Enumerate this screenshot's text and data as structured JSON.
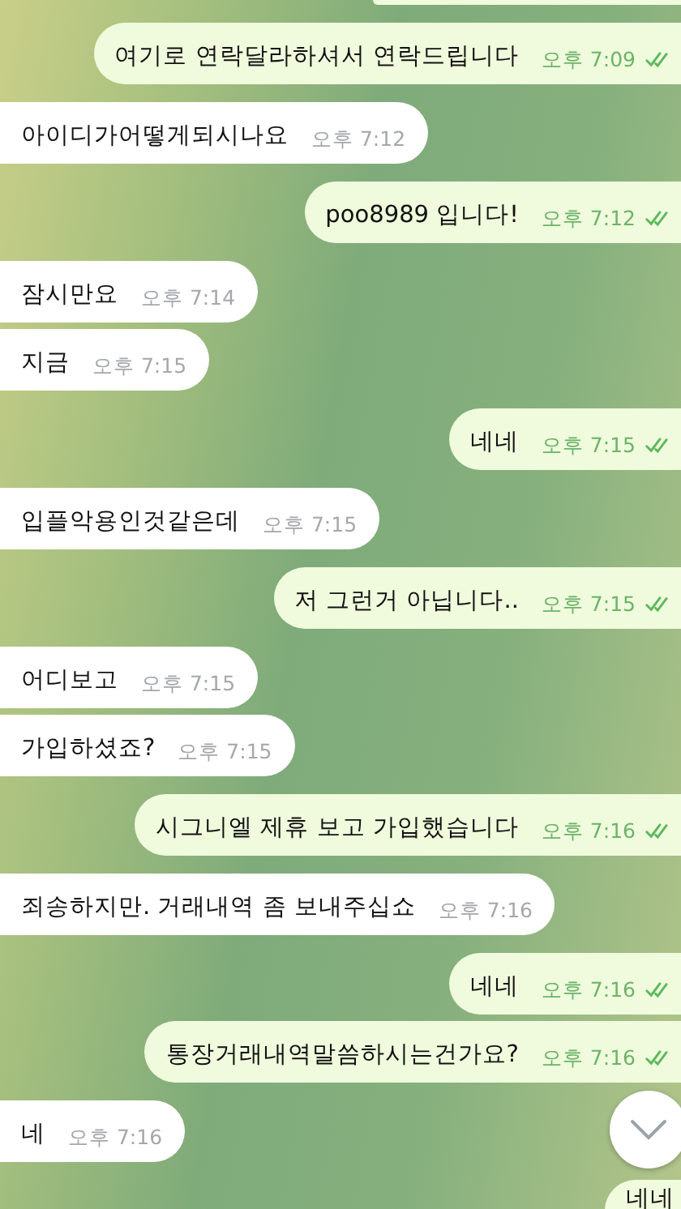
{
  "messages": [
    {
      "kind": "out",
      "text": "여기로 연락달라하셔서 연락드립니다",
      "time": "오후 7:09",
      "read": true
    },
    {
      "kind": "in",
      "text": "아이디가어떻게되시나요",
      "time": "오후 7:12"
    },
    {
      "kind": "out",
      "text": "poo8989 입니다!",
      "time": "오후 7:12",
      "read": true
    },
    {
      "kind": "in",
      "text": "잠시만요",
      "time": "오후 7:14"
    },
    {
      "kind": "in",
      "text": "지금",
      "time": "오후 7:15"
    },
    {
      "kind": "out",
      "text": "네네",
      "time": "오후 7:15",
      "read": true
    },
    {
      "kind": "in",
      "text": "입플악용인것같은데",
      "time": "오후 7:15"
    },
    {
      "kind": "out",
      "text": "저 그런거 아닙니다..",
      "time": "오후 7:15",
      "read": true
    },
    {
      "kind": "in",
      "text": "어디보고",
      "time": "오후 7:15"
    },
    {
      "kind": "in",
      "text": "가입하셨죠?",
      "time": "오후 7:15"
    },
    {
      "kind": "out",
      "text": "시그니엘 제휴 보고 가입했습니다",
      "time": "오후 7:16",
      "read": true
    },
    {
      "kind": "in",
      "text": "죄송하지만. 거래내역 좀 보내주십쇼",
      "time": "오후 7:16"
    },
    {
      "kind": "out",
      "text": "네네",
      "time": "오후 7:16",
      "read": true
    },
    {
      "kind": "out",
      "text": "통장거래내역말씀하시는건가요?",
      "time": "오후 7:16",
      "read": true
    },
    {
      "kind": "in",
      "text": "네",
      "time": "오후 7:16"
    },
    {
      "kind": "out",
      "text": "네네"
    }
  ]
}
